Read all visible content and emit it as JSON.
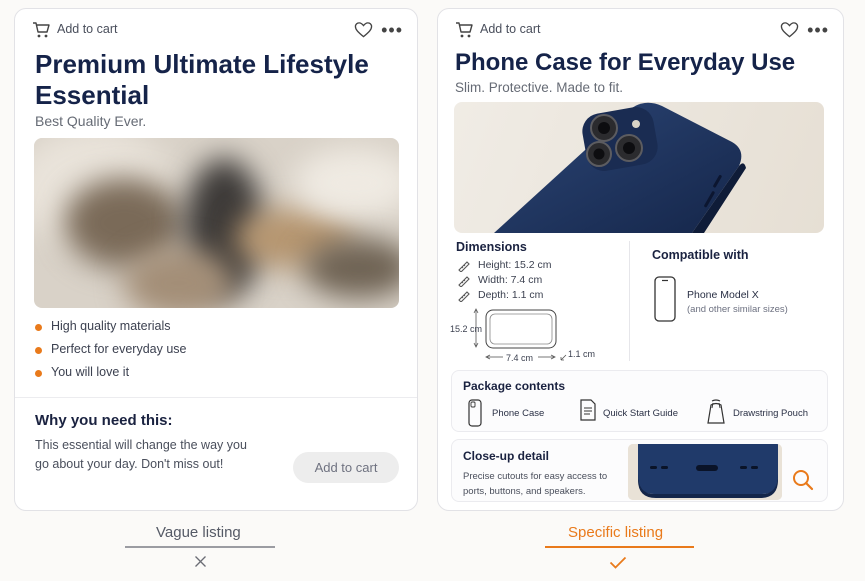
{
  "left_card": {
    "add_to_cart_label": "Add to cart",
    "title": "Premium Ultimate Lifestyle Essential",
    "subtitle": "Best Quality Ever.",
    "bullets": [
      "High quality materials",
      "Perfect for everyday use",
      "You will love it"
    ],
    "why_heading": "Why you need this:",
    "why_text": "This essential will change the way you go about your day. Don't miss out!",
    "cart_button": "Add to cart",
    "caption": "Vague listing",
    "caption_mark": "cross-icon"
  },
  "right_card": {
    "add_to_cart_label": "Add to cart",
    "title": "Phone Case for Everyday Use",
    "subtitle": "Slim. Protective. Made to fit.",
    "dimensions": {
      "heading": "Dimensions",
      "rows": [
        "Height: 15.2 cm",
        "Width: 7.4 cm",
        "Depth: 1.1 cm"
      ],
      "height_label": "15.2 cm",
      "width_label": "7.4 cm",
      "depth_label": "1.1 cm"
    },
    "compatible": {
      "heading": "Compatible with",
      "model": "Phone Model X",
      "note": "(and other similar sizes)"
    },
    "package": {
      "heading": "Package contents",
      "items": [
        "Phone Case",
        "Quick Start Guide",
        "Drawstring Pouch"
      ]
    },
    "closeup": {
      "heading": "Close-up detail",
      "text": "Precise cutouts for easy access to ports, buttons, and speakers."
    },
    "caption": "Specific listing",
    "caption_mark": "check-icon"
  },
  "colors": {
    "accent": "#e97a1b",
    "title": "#152349",
    "case_navy": "#1f3560"
  }
}
